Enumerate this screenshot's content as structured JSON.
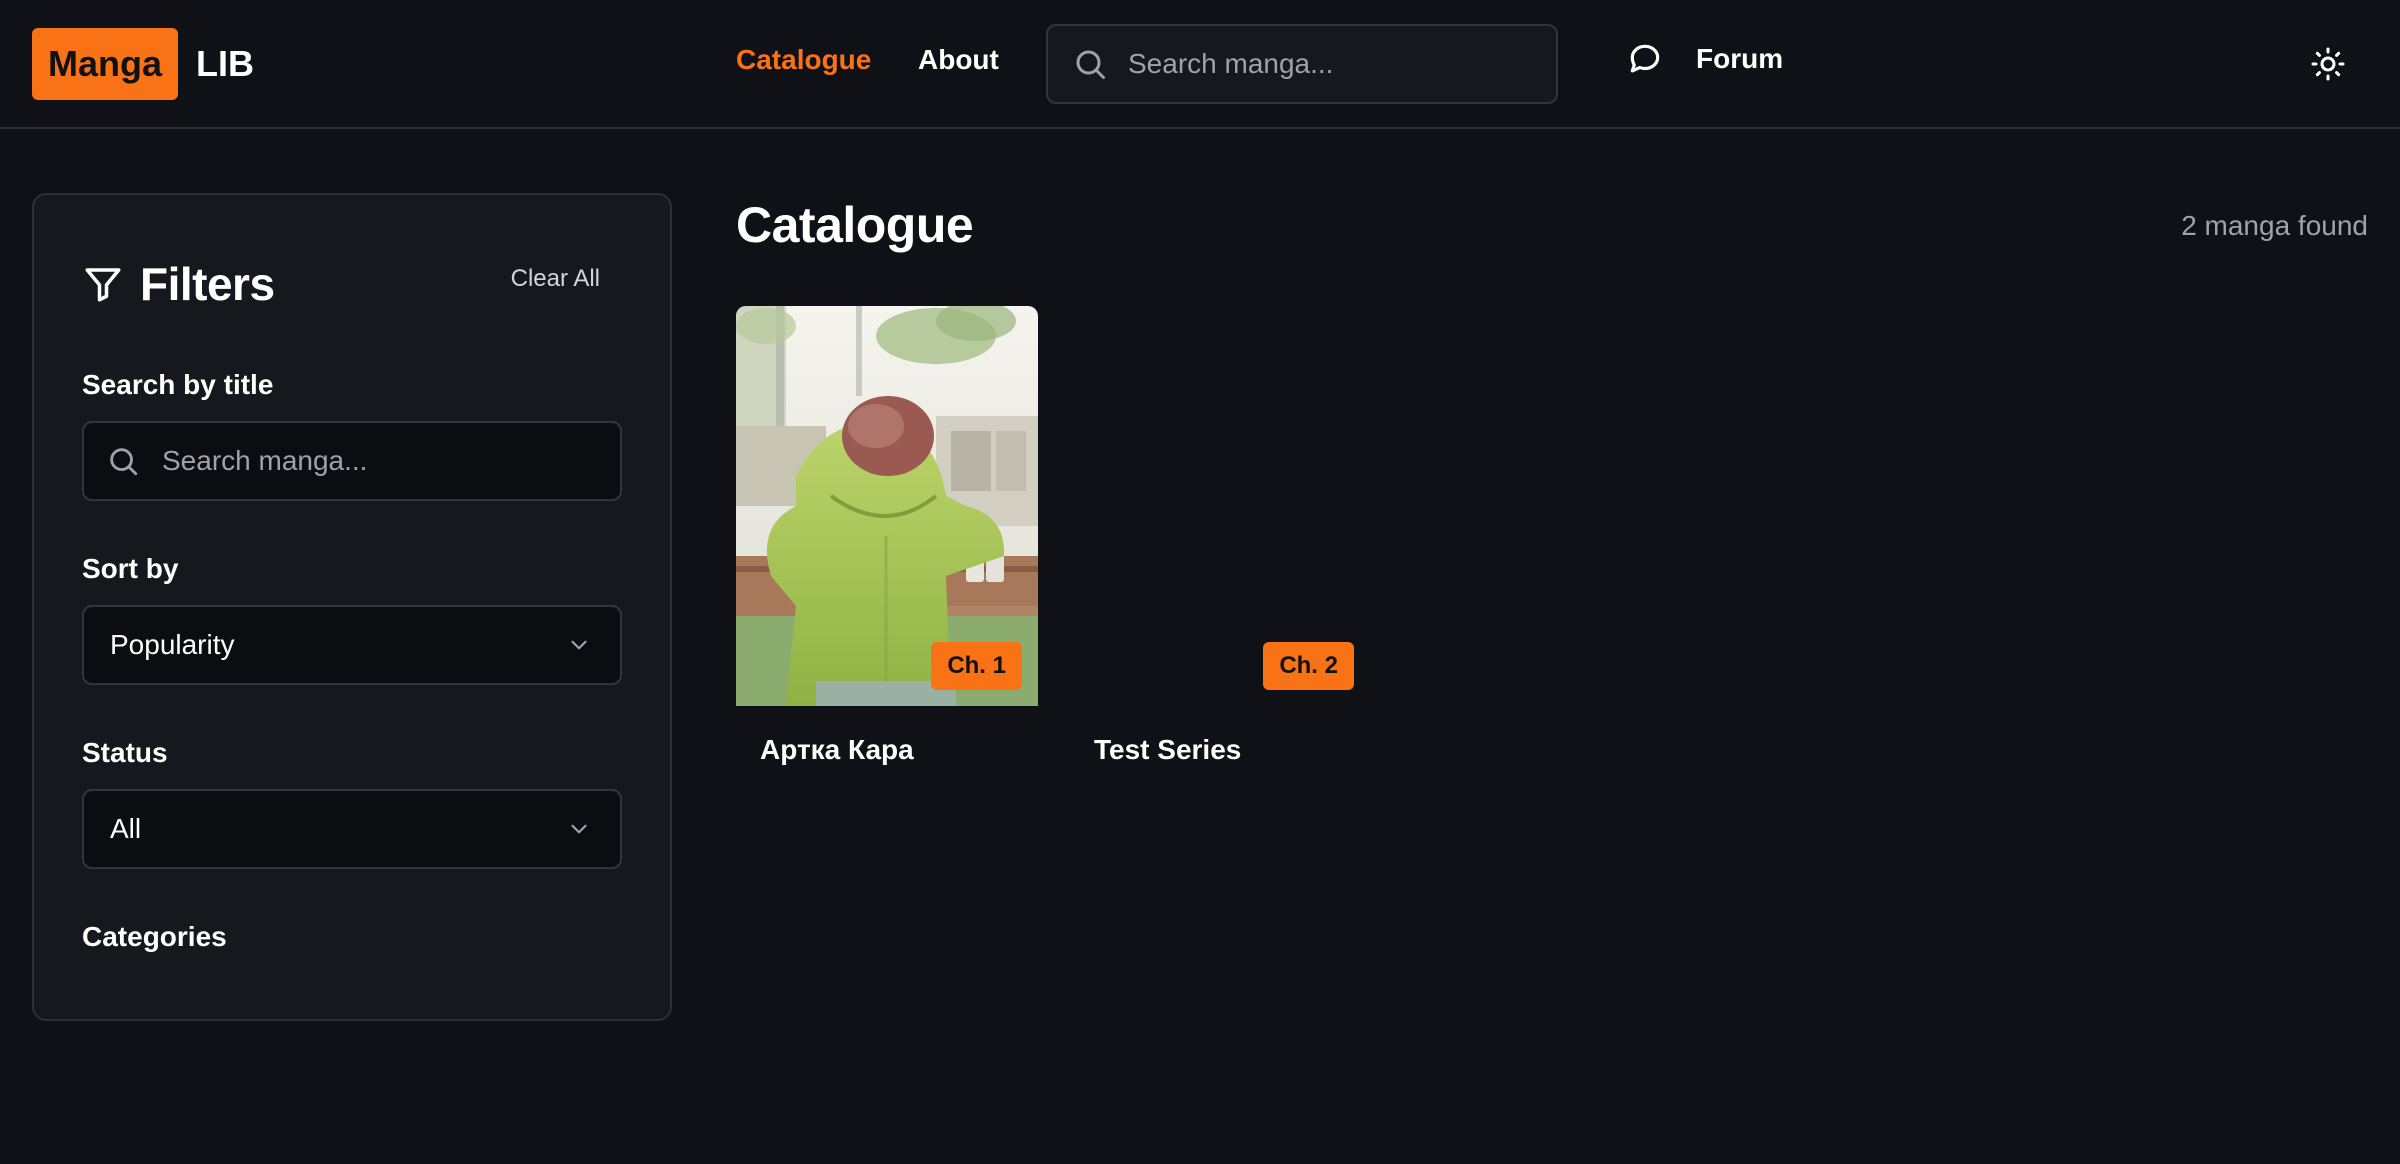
{
  "header": {
    "logo_highlight": "Manga",
    "logo_text": "LIB",
    "nav": {
      "catalogue": "Catalogue",
      "about": "About"
    },
    "search_placeholder": "Search manga...",
    "forum_label": "Forum",
    "accent_color": "#f97316"
  },
  "filters": {
    "title": "Filters",
    "clear_all": "Clear All",
    "search_label": "Search by title",
    "search_placeholder": "Search manga...",
    "sort_label": "Sort by",
    "sort_value": "Popularity",
    "status_label": "Status",
    "status_value": "All",
    "categories_label": "Categories"
  },
  "main": {
    "title": "Catalogue",
    "count_text": "2 manga found",
    "cards": [
      {
        "title": "Артка Кара",
        "badge": "Ch. 1",
        "has_cover": true
      },
      {
        "title": "Test Series",
        "badge": "Ch. 2",
        "has_cover": false
      }
    ]
  }
}
